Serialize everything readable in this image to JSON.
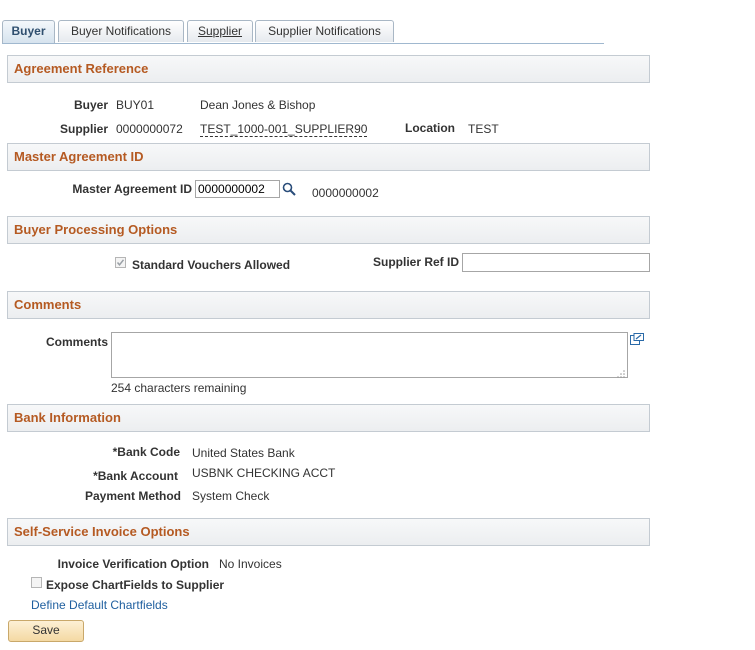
{
  "tabs": [
    {
      "label": "Buyer",
      "active": true
    },
    {
      "label": "Buyer Notifications",
      "active": false
    },
    {
      "label": "Supplier",
      "active": false
    },
    {
      "label": "Supplier Notifications",
      "active": false
    }
  ],
  "sections": {
    "agreement_reference": "Agreement Reference",
    "master_agreement": "Master Agreement ID",
    "buyer_processing": "Buyer Processing Options",
    "comments": "Comments",
    "bank_information": "Bank Information",
    "self_service": "Self-Service Invoice Options"
  },
  "agreement": {
    "buyer_label": "Buyer",
    "buyer_id": "BUY01",
    "buyer_name": "Dean Jones & Bishop",
    "supplier_label": "Supplier",
    "supplier_id": "0000000072",
    "supplier_name": "TEST_1000-001_SUPPLIER90",
    "location_label": "Location",
    "location_value": "TEST"
  },
  "master": {
    "label": "Master Agreement ID",
    "input_value": "0000000002",
    "display_value": "0000000002"
  },
  "processing": {
    "standard_vouchers_label": "Standard Vouchers Allowed",
    "standard_vouchers_checked": true,
    "supplier_ref_label": "Supplier Ref ID",
    "supplier_ref_value": ""
  },
  "comments": {
    "label": "Comments",
    "value": "",
    "remaining": "254 characters remaining"
  },
  "bank": {
    "bank_code_label": "*Bank Code",
    "bank_code_value": "United States Bank",
    "bank_account_label": "*Bank Account",
    "bank_account_value": "USBNK CHECKING ACCT",
    "payment_method_label": "Payment Method",
    "payment_method_value": "System Check"
  },
  "self_service": {
    "verification_label": "Invoice Verification Option",
    "verification_value": "No Invoices",
    "expose_label": "Expose ChartFields to Supplier",
    "expose_checked": false,
    "define_link": "Define Default Chartfields"
  },
  "save_label": "Save"
}
